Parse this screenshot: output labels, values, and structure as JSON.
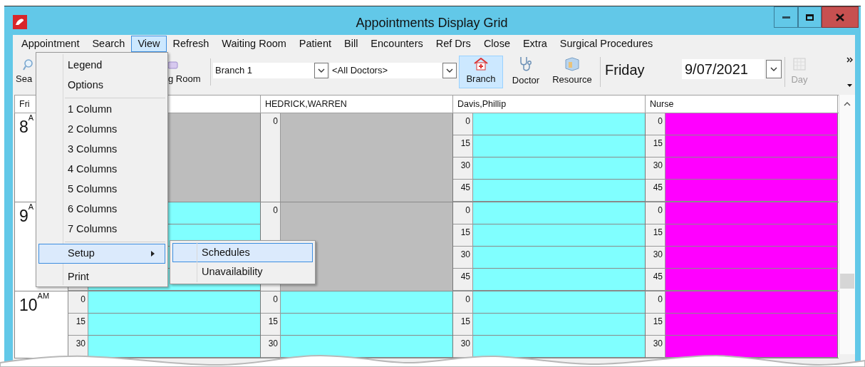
{
  "window": {
    "title": "Appointments Display Grid"
  },
  "menu_bar": [
    {
      "label": "Appointment",
      "selected": false
    },
    {
      "label": "Search",
      "selected": false
    },
    {
      "label": "View",
      "selected": true
    },
    {
      "label": "Refresh",
      "selected": false
    },
    {
      "label": "Waiting Room",
      "selected": false
    },
    {
      "label": "Patient",
      "selected": false
    },
    {
      "label": "Bill",
      "selected": false
    },
    {
      "label": "Encounters",
      "selected": false
    },
    {
      "label": "Ref Drs",
      "selected": false
    },
    {
      "label": "Close",
      "selected": false
    },
    {
      "label": "Extra",
      "selected": false
    },
    {
      "label": "Surgical Procedures",
      "selected": false
    }
  ],
  "toolbar": {
    "search_button": {
      "label": "Sea"
    },
    "waiting_room_button": {
      "label": "g Room"
    },
    "branch_select": {
      "value": "Branch 1"
    },
    "doctor_select": {
      "value": "<All Doctors>"
    },
    "view_modes": [
      {
        "kind": "branch",
        "label": "Branch",
        "selected": true
      },
      {
        "kind": "doctor",
        "label": "Doctor",
        "selected": false
      },
      {
        "kind": "resource",
        "label": "Resource",
        "selected": false
      }
    ],
    "day_name": "Friday",
    "date": {
      "value": "9/07/2021"
    },
    "day_button": {
      "label": "Day",
      "disabled": true
    }
  },
  "grid": {
    "corner": "Fri",
    "hours": [
      {
        "label": "8$^{A}$"
      },
      {
        "label": "9$^{A}$"
      },
      {
        "label": "10$^{AM}$"
      }
    ],
    "columns": [
      {
        "color": "#80ffff",
        "hours": [
          {
            "blocked": true
          },
          {
            "blocked": false
          },
          {
            "blocked": false,
            "minutes": [
              "0",
              "15",
              "30"
            ]
          }
        ]
      },
      {
        "header": "HEDRICK,WARREN",
        "color": "#80ffff",
        "hours": [
          {
            "blocked": true,
            "minutes": [
              "0"
            ]
          },
          {
            "blocked": true,
            "minutes": [
              "0"
            ]
          },
          {
            "blocked": false,
            "minutes": [
              "0",
              "15",
              "30"
            ]
          }
        ]
      },
      {
        "header": "Davis,Phillip",
        "color": "#80ffff",
        "hours": [
          {
            "blocked": false,
            "minutes": [
              "0",
              "15",
              "30",
              "45"
            ]
          },
          {
            "blocked": false,
            "minutes": [
              "0",
              "15",
              "30",
              "45"
            ]
          },
          {
            "blocked": false,
            "minutes": [
              "0",
              "15",
              "30"
            ]
          }
        ]
      },
      {
        "header": "Nurse",
        "color": "#ff00ff",
        "hours": [
          {
            "blocked": false,
            "minutes": [
              "0",
              "15",
              "30",
              "45"
            ]
          },
          {
            "blocked": false,
            "minutes": [
              "0",
              "15",
              "30",
              "45"
            ]
          },
          {
            "blocked": false,
            "minutes": [
              "0",
              "15",
              "30"
            ]
          }
        ]
      }
    ]
  },
  "view_menu": {
    "items": [
      {
        "kind": "item",
        "label": "Legend",
        "selected": false
      },
      {
        "kind": "item",
        "label": "Options",
        "selected": false
      },
      {
        "kind": "separator"
      },
      {
        "kind": "item",
        "label": "1 Column",
        "selected": false
      },
      {
        "kind": "item",
        "label": "2 Columns",
        "selected": false
      },
      {
        "kind": "item",
        "label": "3 Columns",
        "selected": false
      },
      {
        "kind": "item",
        "label": "4 Columns",
        "selected": false
      },
      {
        "kind": "item",
        "label": "5 Columns",
        "selected": false
      },
      {
        "kind": "item",
        "label": "6 Columns",
        "selected": false
      },
      {
        "kind": "item",
        "label": "7 Columns",
        "selected": false
      },
      {
        "kind": "separator"
      },
      {
        "kind": "submenu",
        "label": "Setup",
        "selected": true
      },
      {
        "kind": "item",
        "label": "Print",
        "selected": false
      }
    ]
  },
  "setup_submenu": {
    "items": [
      {
        "label": "Schedules",
        "selected": true
      },
      {
        "label": "Unavailability",
        "selected": false
      }
    ]
  }
}
